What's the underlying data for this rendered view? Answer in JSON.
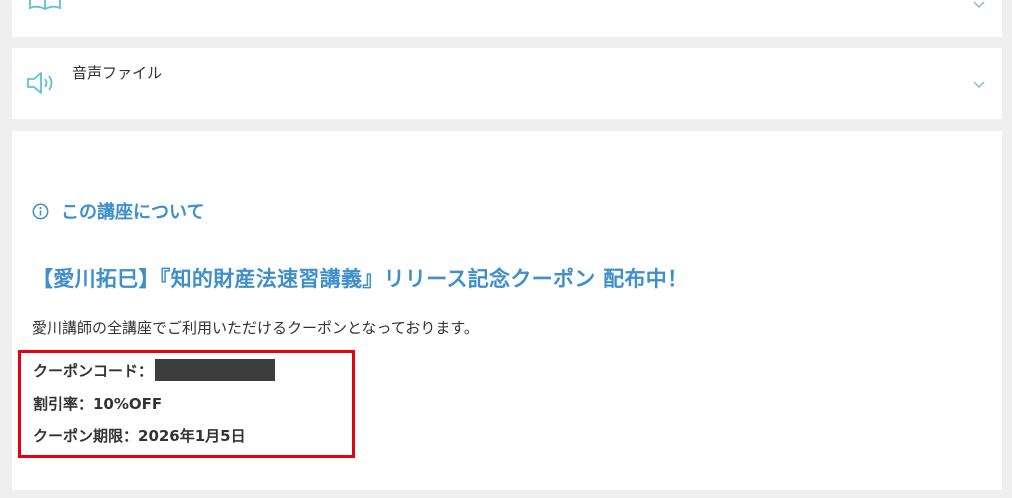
{
  "sections": {
    "audio": {
      "label": "音声ファイル"
    }
  },
  "about": {
    "title": "この講座について",
    "campaign_title": "【愛川拓巳】『知的財産法速習講義』リリース記念クーポン 配布中！",
    "description": "愛川講師の全講座でご利用いただけるクーポンとなっております。",
    "coupon": {
      "code_label": "クーポンコード：",
      "rate": "割引率：10%OFF",
      "expiry": "クーポン期限：2026年1月5日"
    }
  },
  "icons": {
    "book": "book-icon",
    "speaker": "speaker-icon",
    "info": "info-icon",
    "chevron": "chevron-down-icon"
  },
  "colors": {
    "accent": "#3f8fcb",
    "icon": "#5bc2d6",
    "highlight_border": "#e60012",
    "text": "#333333"
  }
}
